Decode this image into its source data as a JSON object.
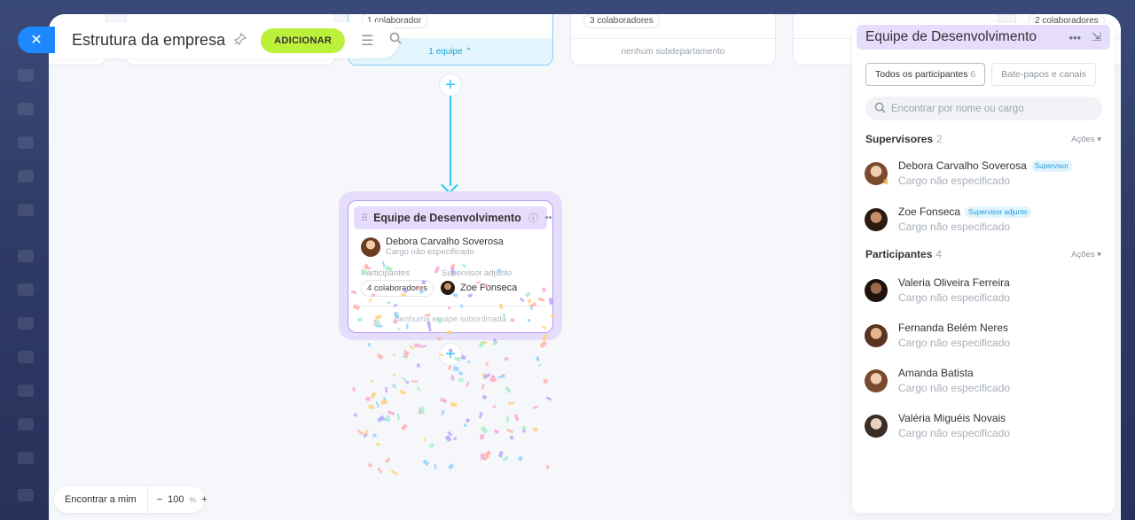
{
  "header": {
    "title": "Estrutura da empresa",
    "add_label": "ADICIONAR"
  },
  "top_cards": [
    {
      "chip": "1 colaborador",
      "footer": "1 equipe ⌃"
    },
    {
      "chip": "3 colaboradores",
      "footer": "nenhum subdepartamento"
    },
    {
      "chip": "2 colaboradores",
      "footer": ""
    }
  ],
  "team_card": {
    "name": "Equipe de Desenvolvimento",
    "lead_name": "Debora Carvalho Soverosa",
    "lead_role": "Cargo não especificado",
    "participants_label": "Participantes",
    "participants_chip": "4 colaboradores",
    "deputy_label": "Supervisor adjunto",
    "deputy_name": "Zoe Fonseca",
    "footer": "nenhuma equipe subordinada"
  },
  "bottom": {
    "find_me": "Encontrar a mim",
    "zoom_value": "100",
    "zoom_unit": "%"
  },
  "panel": {
    "title": "Equipe de Desenvolvimento",
    "tabs": [
      {
        "label": "Todos os participantes",
        "count": "6"
      },
      {
        "label": "Bate-papos e canais"
      }
    ],
    "search_placeholder": "Encontrar por nome ou cargo",
    "supervisors": {
      "heading": "Supervisores",
      "count": "2",
      "actions": "Ações",
      "people": [
        {
          "name": "Debora Carvalho Soverosa",
          "badge": "Supervisor",
          "role": "Cargo não especificado"
        },
        {
          "name": "Zoe Fonseca",
          "badge": "Supervisor adjunto",
          "role": "Cargo não especificado"
        }
      ]
    },
    "participants": {
      "heading": "Participantes",
      "count": "4",
      "actions": "Ações",
      "people": [
        {
          "name": "Valeria Oliveira Ferreira",
          "role": "Cargo não especificado"
        },
        {
          "name": "Fernanda Belém Neres",
          "role": "Cargo não especificado"
        },
        {
          "name": "Amanda Batista",
          "role": "Cargo não especificado"
        },
        {
          "name": "Valéria Miguéis Novais",
          "role": "Cargo não especificado"
        }
      ]
    }
  },
  "colors": {
    "accent_blue": "#2fc6f6",
    "add_button": "#bdf03b",
    "team_purple": "#e6dcfb",
    "close_blue": "#1e88ff"
  }
}
